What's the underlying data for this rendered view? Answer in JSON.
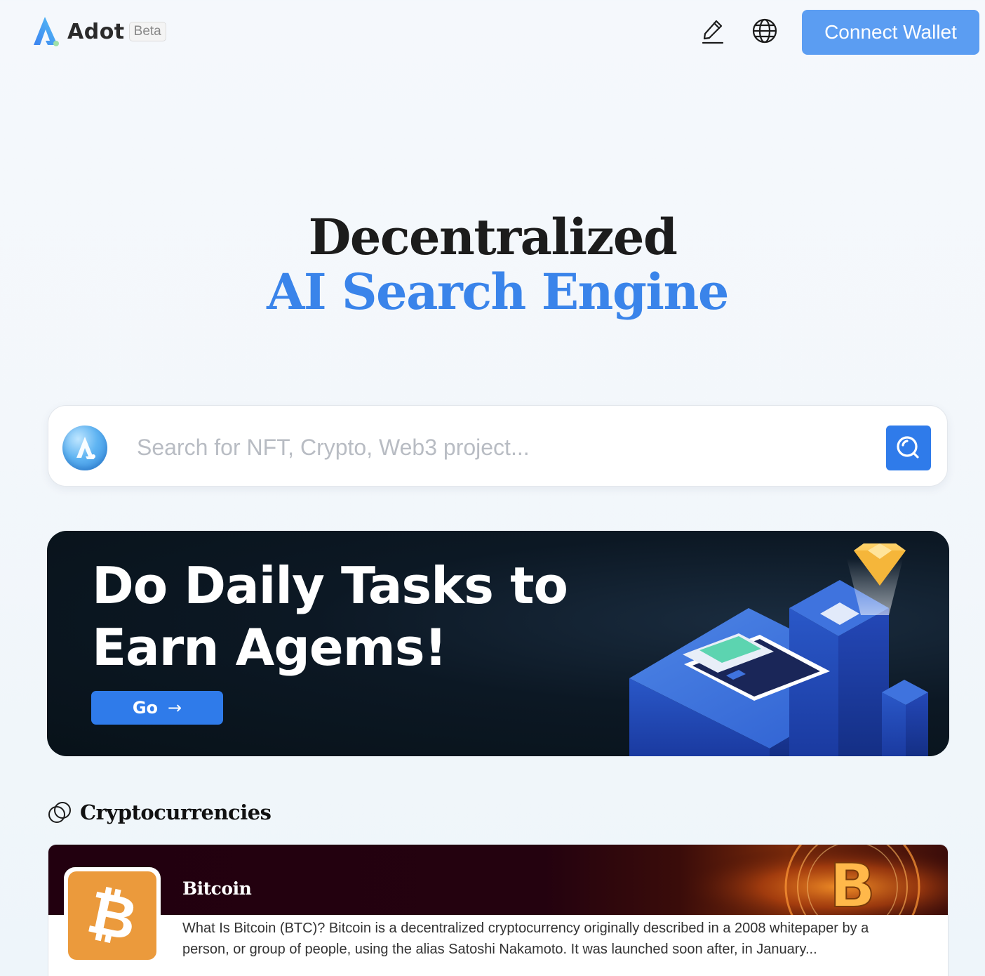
{
  "brand": {
    "name": "Adot",
    "badge": "Beta"
  },
  "header": {
    "edit_icon": "edit-pencil-icon",
    "language_icon": "globe-icon",
    "connect_label": "Connect Wallet"
  },
  "hero": {
    "line1": "Decentralized",
    "line2": "AI Search Engine"
  },
  "search": {
    "placeholder": "Search for NFT, Crypto, Web3 project...",
    "value": "",
    "button_icon": "search-icon"
  },
  "promo": {
    "title_line1": "Do Daily Tasks to",
    "title_line2": "Earn Agems!",
    "button_label": "Go",
    "button_arrow": "→"
  },
  "section": {
    "icon": "coins-icon",
    "title": "Cryptocurrencies"
  },
  "cryptos": [
    {
      "name": "Bitcoin",
      "symbol_glyph": "₿",
      "description": "What Is Bitcoin (BTC)? Bitcoin is a decentralized cryptocurrency originally described in a 2008 whitepaper by a person, or group of people, using the alias Satoshi Nakamoto. It was launched soon after, in January..."
    }
  ],
  "colors": {
    "accent": "#3a84ea",
    "button": "#5b9df2",
    "banner_bg": "#0c1824",
    "bitcoin_orange": "#eb9a3c"
  }
}
